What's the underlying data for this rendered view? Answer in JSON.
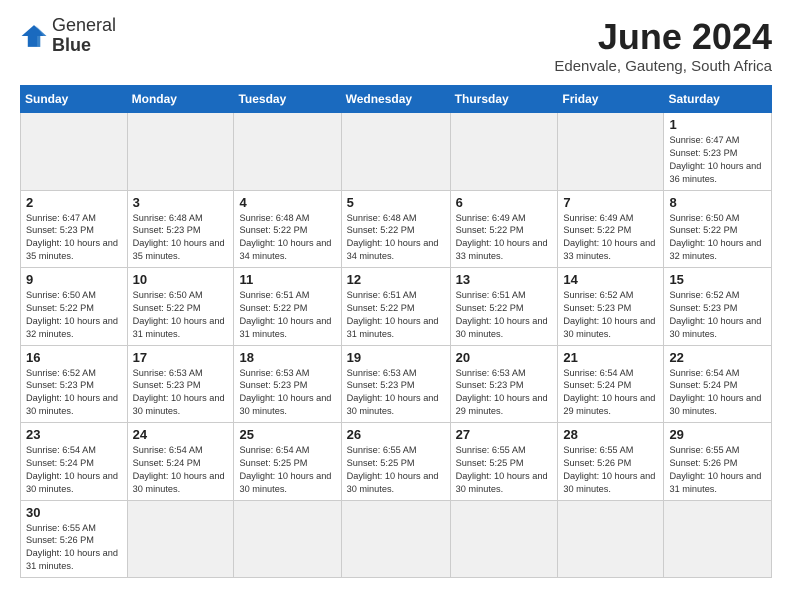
{
  "header": {
    "logo_text_normal": "General",
    "logo_text_bold": "Blue",
    "month": "June 2024",
    "location": "Edenvale, Gauteng, South Africa"
  },
  "weekdays": [
    "Sunday",
    "Monday",
    "Tuesday",
    "Wednesday",
    "Thursday",
    "Friday",
    "Saturday"
  ],
  "weeks": [
    [
      {
        "day": "",
        "empty": true
      },
      {
        "day": "",
        "empty": true
      },
      {
        "day": "",
        "empty": true
      },
      {
        "day": "",
        "empty": true
      },
      {
        "day": "",
        "empty": true
      },
      {
        "day": "",
        "empty": true
      },
      {
        "day": "1",
        "sunrise": "6:47 AM",
        "sunset": "5:23 PM",
        "daylight": "10 hours and 36 minutes."
      }
    ],
    [
      {
        "day": "2",
        "sunrise": "6:47 AM",
        "sunset": "5:23 PM",
        "daylight": "10 hours and 35 minutes."
      },
      {
        "day": "3",
        "sunrise": "6:48 AM",
        "sunset": "5:23 PM",
        "daylight": "10 hours and 35 minutes."
      },
      {
        "day": "4",
        "sunrise": "6:48 AM",
        "sunset": "5:22 PM",
        "daylight": "10 hours and 34 minutes."
      },
      {
        "day": "5",
        "sunrise": "6:48 AM",
        "sunset": "5:22 PM",
        "daylight": "10 hours and 34 minutes."
      },
      {
        "day": "6",
        "sunrise": "6:49 AM",
        "sunset": "5:22 PM",
        "daylight": "10 hours and 33 minutes."
      },
      {
        "day": "7",
        "sunrise": "6:49 AM",
        "sunset": "5:22 PM",
        "daylight": "10 hours and 33 minutes."
      },
      {
        "day": "8",
        "sunrise": "6:50 AM",
        "sunset": "5:22 PM",
        "daylight": "10 hours and 32 minutes."
      }
    ],
    [
      {
        "day": "9",
        "sunrise": "6:50 AM",
        "sunset": "5:22 PM",
        "daylight": "10 hours and 32 minutes."
      },
      {
        "day": "10",
        "sunrise": "6:50 AM",
        "sunset": "5:22 PM",
        "daylight": "10 hours and 31 minutes."
      },
      {
        "day": "11",
        "sunrise": "6:51 AM",
        "sunset": "5:22 PM",
        "daylight": "10 hours and 31 minutes."
      },
      {
        "day": "12",
        "sunrise": "6:51 AM",
        "sunset": "5:22 PM",
        "daylight": "10 hours and 31 minutes."
      },
      {
        "day": "13",
        "sunrise": "6:51 AM",
        "sunset": "5:22 PM",
        "daylight": "10 hours and 30 minutes."
      },
      {
        "day": "14",
        "sunrise": "6:52 AM",
        "sunset": "5:23 PM",
        "daylight": "10 hours and 30 minutes."
      },
      {
        "day": "15",
        "sunrise": "6:52 AM",
        "sunset": "5:23 PM",
        "daylight": "10 hours and 30 minutes."
      }
    ],
    [
      {
        "day": "16",
        "sunrise": "6:52 AM",
        "sunset": "5:23 PM",
        "daylight": "10 hours and 30 minutes."
      },
      {
        "day": "17",
        "sunrise": "6:53 AM",
        "sunset": "5:23 PM",
        "daylight": "10 hours and 30 minutes."
      },
      {
        "day": "18",
        "sunrise": "6:53 AM",
        "sunset": "5:23 PM",
        "daylight": "10 hours and 30 minutes."
      },
      {
        "day": "19",
        "sunrise": "6:53 AM",
        "sunset": "5:23 PM",
        "daylight": "10 hours and 30 minutes."
      },
      {
        "day": "20",
        "sunrise": "6:53 AM",
        "sunset": "5:23 PM",
        "daylight": "10 hours and 29 minutes."
      },
      {
        "day": "21",
        "sunrise": "6:54 AM",
        "sunset": "5:24 PM",
        "daylight": "10 hours and 29 minutes."
      },
      {
        "day": "22",
        "sunrise": "6:54 AM",
        "sunset": "5:24 PM",
        "daylight": "10 hours and 30 minutes."
      }
    ],
    [
      {
        "day": "23",
        "sunrise": "6:54 AM",
        "sunset": "5:24 PM",
        "daylight": "10 hours and 30 minutes."
      },
      {
        "day": "24",
        "sunrise": "6:54 AM",
        "sunset": "5:24 PM",
        "daylight": "10 hours and 30 minutes."
      },
      {
        "day": "25",
        "sunrise": "6:54 AM",
        "sunset": "5:25 PM",
        "daylight": "10 hours and 30 minutes."
      },
      {
        "day": "26",
        "sunrise": "6:55 AM",
        "sunset": "5:25 PM",
        "daylight": "10 hours and 30 minutes."
      },
      {
        "day": "27",
        "sunrise": "6:55 AM",
        "sunset": "5:25 PM",
        "daylight": "10 hours and 30 minutes."
      },
      {
        "day": "28",
        "sunrise": "6:55 AM",
        "sunset": "5:26 PM",
        "daylight": "10 hours and 30 minutes."
      },
      {
        "day": "29",
        "sunrise": "6:55 AM",
        "sunset": "5:26 PM",
        "daylight": "10 hours and 31 minutes."
      }
    ],
    [
      {
        "day": "30",
        "sunrise": "6:55 AM",
        "sunset": "5:26 PM",
        "daylight": "10 hours and 31 minutes."
      },
      {
        "day": "",
        "empty": true
      },
      {
        "day": "",
        "empty": true
      },
      {
        "day": "",
        "empty": true
      },
      {
        "day": "",
        "empty": true
      },
      {
        "day": "",
        "empty": true
      },
      {
        "day": "",
        "empty": true
      }
    ]
  ]
}
